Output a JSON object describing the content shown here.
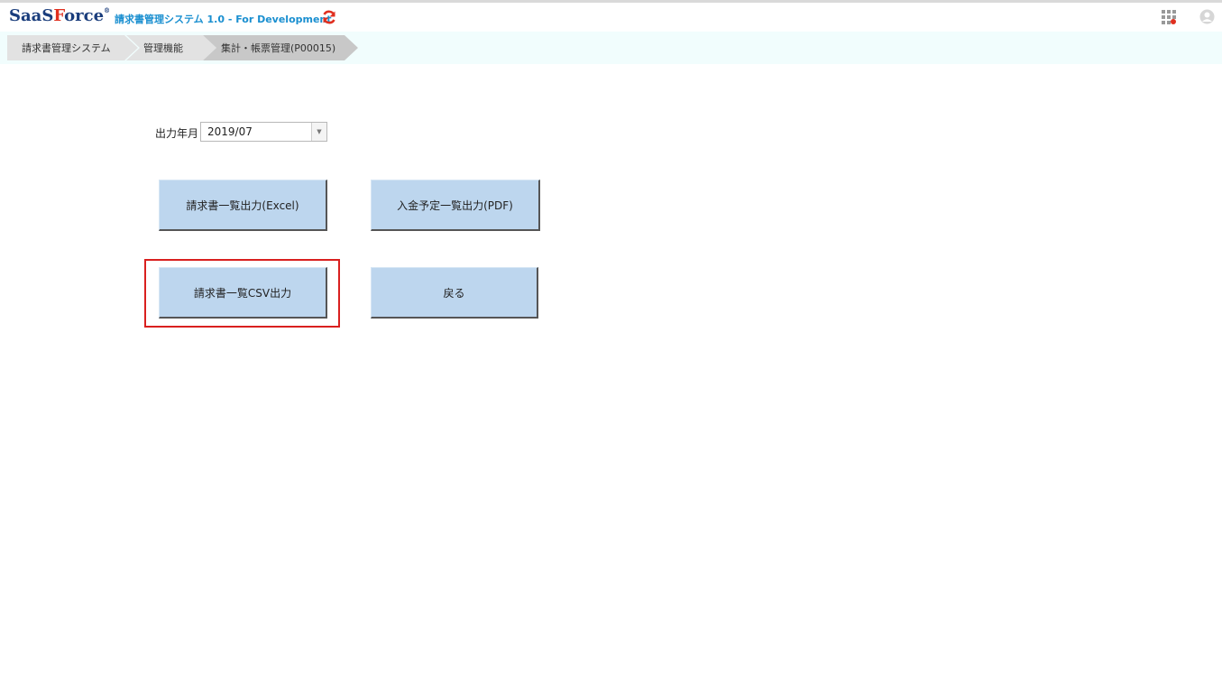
{
  "header": {
    "logo_saas": "SaaS",
    "logo_f": "F",
    "logo_orce": "orce",
    "logo_reg": "®",
    "app_title": "請求書管理システム 1.0 - For Development"
  },
  "breadcrumb": {
    "items": [
      {
        "label": "請求書管理システム"
      },
      {
        "label": "管理機能"
      },
      {
        "label": "集計・帳票管理(P00015)"
      }
    ]
  },
  "form": {
    "month_label": "出力年月",
    "month_value": "2019/07"
  },
  "buttons": {
    "invoice_excel": "請求書一覧出力(Excel)",
    "payment_pdf": "入金予定一覧出力(PDF)",
    "invoice_csv": "請求書一覧CSV出力",
    "back": "戻る"
  },
  "colors": {
    "button_bg": "#bdd6ee",
    "highlight": "#d9201f",
    "breadcrumb_bg": "#f1fdfd",
    "title_blue": "#1a8fd0"
  }
}
